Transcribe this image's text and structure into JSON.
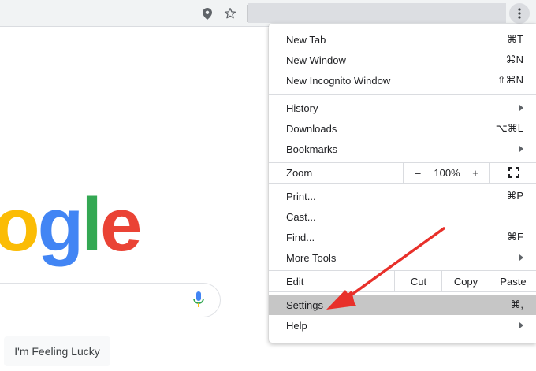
{
  "menu": {
    "new_tab": {
      "label": "New Tab",
      "shortcut": "⌘T"
    },
    "new_window": {
      "label": "New Window",
      "shortcut": "⌘N"
    },
    "new_incognito": {
      "label": "New Incognito Window",
      "shortcut": "⇧⌘N"
    },
    "history": {
      "label": "History"
    },
    "downloads": {
      "label": "Downloads",
      "shortcut": "⌥⌘L"
    },
    "bookmarks": {
      "label": "Bookmarks"
    },
    "zoom": {
      "label": "Zoom",
      "minus": "–",
      "level": "100%",
      "plus": "+"
    },
    "print": {
      "label": "Print...",
      "shortcut": "⌘P"
    },
    "cast": {
      "label": "Cast..."
    },
    "find": {
      "label": "Find...",
      "shortcut": "⌘F"
    },
    "more_tools": {
      "label": "More Tools"
    },
    "edit": {
      "label": "Edit",
      "cut": "Cut",
      "copy": "Copy",
      "paste": "Paste"
    },
    "settings": {
      "label": "Settings",
      "shortcut": "⌘,"
    },
    "help": {
      "label": "Help"
    }
  },
  "page": {
    "logo_letters": [
      "o",
      "g",
      "l",
      "e"
    ],
    "logo_colors": [
      "#fbbc05",
      "#4285f4",
      "#34a853",
      "#ea4335"
    ],
    "lucky_button": "I'm Feeling Lucky"
  },
  "toolbar": {
    "icons": [
      "location-icon",
      "star-icon",
      "more-vert-icon"
    ]
  },
  "colors": {
    "highlight": "#c6c6c6",
    "annotation": "#e8302a"
  }
}
